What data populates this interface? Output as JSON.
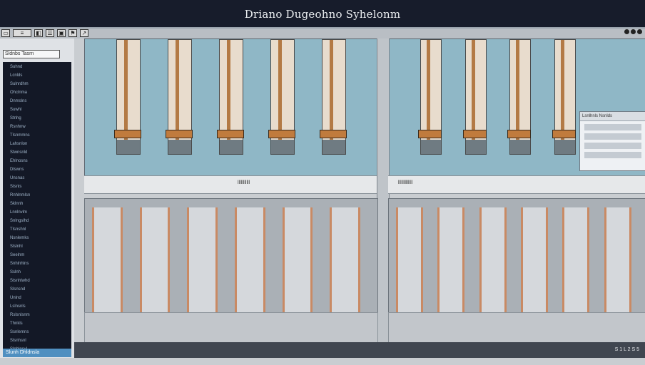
{
  "window": {
    "title": "Driano Dugeohno Syhelonm"
  },
  "toolbar": {
    "left_icons": [
      "file-icon",
      "save-icon",
      "folder-icon",
      "settings-icon",
      "view-icon",
      "flag-icon",
      "pointer-icon"
    ],
    "right_controls": [
      "minimize-icon",
      "maximize-icon",
      "close-icon"
    ]
  },
  "sidebar": {
    "header": "Sldnbs Tasrn",
    "items": [
      "Suhnd",
      "Lcnlds",
      "Sulnrdhm",
      "Ohclnma",
      "Dnmslns",
      "Suwhl",
      "Stnhg",
      "Rsnhnw",
      "Tlsnmmns",
      "Lahsnlon",
      "Stwnsnld",
      "Ehlnosns",
      "Dlswns",
      "Unsnas",
      "Stsnls",
      "Rnhlnmlsn",
      "Sklnnh",
      "Lnnlnvlm",
      "Snlngslhd",
      "Tlsnshnl",
      "Nsnlemks",
      "Slslnhl",
      "Seelnm",
      "Snhlnhlns",
      "Sslnh",
      "Stsnhlwhd",
      "Slsnsnd",
      "Unlnd",
      "Lslnsnls",
      "Rslsnlsnm",
      "Thnkls",
      "Ssnlemns",
      "Slsnhsnl",
      "Slnhlnsvl"
    ],
    "footer": "Slunh Dhldnsla"
  },
  "panels": {
    "left_strip_label": "lllllllllll",
    "right_strip_label": "lllllllllllll",
    "popup_header": "Lsnlhnls Nsnlds"
  },
  "status": {
    "readout": "S 1 L 2 S 5"
  },
  "colors": {
    "titlebar": "#171c2b",
    "sidebar_list": "#131826",
    "accent_copper": "#c07b3d",
    "panel_bg": "#8fb7c6"
  }
}
